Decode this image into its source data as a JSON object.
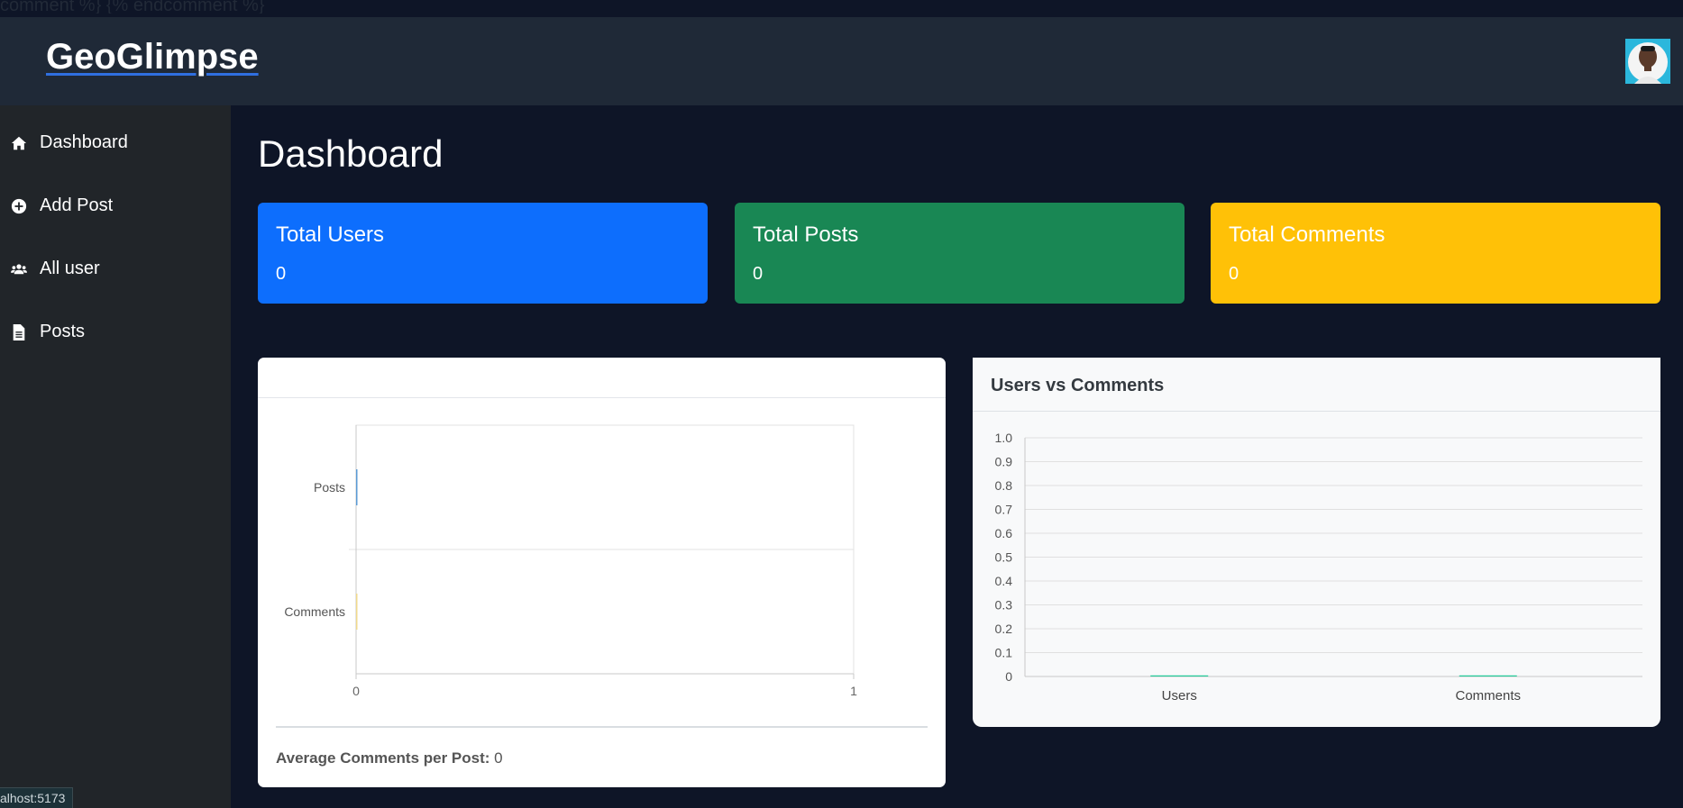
{
  "stray_text": "comment %} {% endcomment %}",
  "brand": "GeoGlimpse",
  "sidebar": {
    "items": [
      {
        "label": "Dashboard",
        "icon": "home-icon"
      },
      {
        "label": "Add Post",
        "icon": "plus-circle-icon"
      },
      {
        "label": "All user",
        "icon": "users-icon"
      },
      {
        "label": "Posts",
        "icon": "document-icon"
      }
    ]
  },
  "status_url": "alhost:5173",
  "page_title": "Dashboard",
  "stats": [
    {
      "label": "Total Users",
      "value": "0",
      "color": "#0d6efd"
    },
    {
      "label": "Total Posts",
      "value": "0",
      "color": "#198754"
    },
    {
      "label": "Total Comments",
      "value": "0",
      "color": "#ffc107"
    }
  ],
  "left_card": {
    "avg_label": "Average Comments per Post:",
    "avg_value": "0"
  },
  "right_card": {
    "title": "Users vs Comments"
  },
  "chart_data": [
    {
      "type": "bar",
      "orientation": "horizontal",
      "categories": [
        "Posts",
        "Comments"
      ],
      "values": [
        0,
        0
      ],
      "xlim": [
        0,
        1
      ],
      "x_ticks": [
        "0",
        "1"
      ],
      "colors": [
        "#5b9bd5",
        "#f0d98c"
      ],
      "grid": true
    },
    {
      "type": "bar",
      "title": "Users vs Comments",
      "categories": [
        "Users",
        "Comments"
      ],
      "values": [
        0,
        0
      ],
      "ylim": [
        0,
        1.0
      ],
      "y_ticks": [
        "0",
        "0.1",
        "0.2",
        "0.3",
        "0.4",
        "0.5",
        "0.6",
        "0.7",
        "0.8",
        "0.9",
        "1.0"
      ],
      "colors": [
        "#20c997",
        "#20c997"
      ],
      "grid": true
    }
  ]
}
